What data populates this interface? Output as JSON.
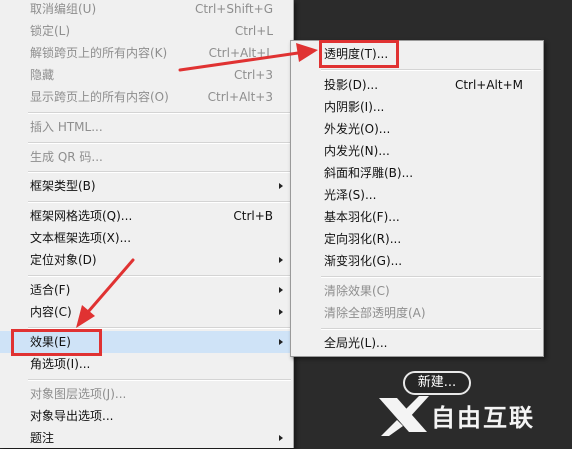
{
  "main_menu": {
    "items": [
      {
        "label": "取消编组(U)",
        "shortcut": "Ctrl+Shift+G"
      },
      {
        "label": "锁定(L)",
        "shortcut": "Ctrl+L"
      },
      {
        "label": "解锁跨页上的所有内容(K)",
        "shortcut": "Ctrl+Alt+L"
      },
      {
        "label": "隐藏",
        "shortcut": "Ctrl+3"
      },
      {
        "label": "显示跨页上的所有内容(O)",
        "shortcut": "Ctrl+Alt+3"
      },
      {
        "label": "插入 HTML..."
      },
      {
        "label": "生成 QR 码..."
      },
      {
        "label": "框架类型(B)"
      },
      {
        "label": "框架网格选项(Q)...",
        "shortcut": "Ctrl+B"
      },
      {
        "label": "文本框架选项(X)..."
      },
      {
        "label": "定位对象(D)"
      },
      {
        "label": "适合(F)"
      },
      {
        "label": "内容(C)"
      },
      {
        "label": "效果(E)"
      },
      {
        "label": "角选项(I)..."
      },
      {
        "label": "对象图层选项(J)..."
      },
      {
        "label": "对象导出选项..."
      },
      {
        "label": "题注"
      }
    ]
  },
  "effects_submenu": {
    "items": [
      {
        "label": "透明度(T)..."
      },
      {
        "label": "投影(D)...",
        "shortcut": "Ctrl+Alt+M"
      },
      {
        "label": "内阴影(I)..."
      },
      {
        "label": "外发光(O)..."
      },
      {
        "label": "内发光(N)..."
      },
      {
        "label": "斜面和浮雕(B)..."
      },
      {
        "label": "光泽(S)..."
      },
      {
        "label": "基本羽化(F)..."
      },
      {
        "label": "定向羽化(R)..."
      },
      {
        "label": "渐变羽化(G)..."
      },
      {
        "label": "清除效果(C)"
      },
      {
        "label": "清除全部透明度(A)"
      },
      {
        "label": "全局光(L)..."
      }
    ]
  },
  "new_button": {
    "label": "新建..."
  },
  "watermark": {
    "text": "自由互联"
  },
  "colors": {
    "annotation_red": "#e03232",
    "menu_bg": "#f0f0f0",
    "highlight": "#cfe3f7",
    "disabled": "#8e8e8e"
  }
}
